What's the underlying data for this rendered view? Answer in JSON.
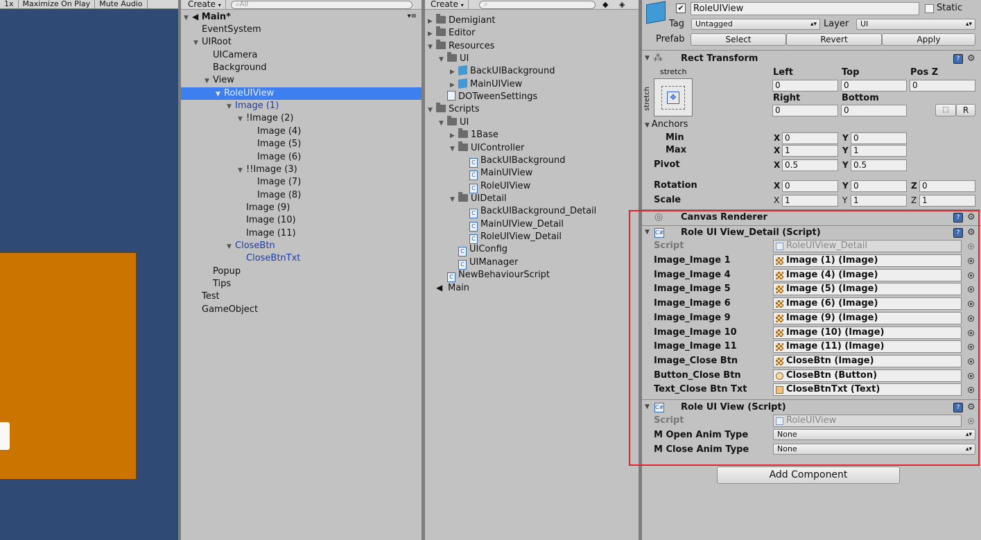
{
  "game": {
    "toolbar": [
      "1x",
      "Maximize On Play",
      "Mute Audio"
    ]
  },
  "hierarchy": {
    "create_label": "Create",
    "search_placeholder": "All",
    "scene_name": "Main*",
    "items": [
      {
        "label": "EventSystem",
        "depth": 0,
        "fold": ""
      },
      {
        "label": "UIRoot",
        "depth": 0,
        "fold": "open"
      },
      {
        "label": "UICamera",
        "depth": 1,
        "fold": ""
      },
      {
        "label": "Background",
        "depth": 1,
        "fold": ""
      },
      {
        "label": "View",
        "depth": 1,
        "fold": "open"
      },
      {
        "label": "RoleUIView",
        "depth": 2,
        "fold": "open",
        "selected": true
      },
      {
        "label": "Image (1)",
        "depth": 3,
        "fold": "open",
        "prefab": true
      },
      {
        "label": "!Image (2)",
        "depth": 4,
        "fold": "open"
      },
      {
        "label": "Image (4)",
        "depth": 5,
        "fold": ""
      },
      {
        "label": "Image (5)",
        "depth": 5,
        "fold": ""
      },
      {
        "label": "Image (6)",
        "depth": 5,
        "fold": ""
      },
      {
        "label": "!!Image (3)",
        "depth": 4,
        "fold": "open"
      },
      {
        "label": "Image (7)",
        "depth": 5,
        "fold": ""
      },
      {
        "label": "Image (8)",
        "depth": 5,
        "fold": ""
      },
      {
        "label": "Image (9)",
        "depth": 4,
        "fold": ""
      },
      {
        "label": "Image (10)",
        "depth": 4,
        "fold": ""
      },
      {
        "label": "Image (11)",
        "depth": 4,
        "fold": ""
      },
      {
        "label": "CloseBtn",
        "depth": 3,
        "fold": "open",
        "prefab": true
      },
      {
        "label": "CloseBtnTxt",
        "depth": 4,
        "fold": "",
        "prefab": true
      },
      {
        "label": "Popup",
        "depth": 1,
        "fold": ""
      },
      {
        "label": "Tips",
        "depth": 1,
        "fold": ""
      },
      {
        "label": "Test",
        "depth": 0,
        "fold": ""
      },
      {
        "label": "GameObject",
        "depth": 0,
        "fold": ""
      }
    ]
  },
  "project": {
    "create_label": "Create",
    "items": [
      {
        "label": "Demigiant",
        "depth": 0,
        "fold": "closed",
        "icon": "folder"
      },
      {
        "label": "Editor",
        "depth": 0,
        "fold": "closed",
        "icon": "folder"
      },
      {
        "label": "Resources",
        "depth": 0,
        "fold": "open",
        "icon": "folder"
      },
      {
        "label": "UI",
        "depth": 1,
        "fold": "open",
        "icon": "folder"
      },
      {
        "label": "BackUIBackground",
        "depth": 2,
        "fold": "closed",
        "icon": "prefab"
      },
      {
        "label": "MainUIView",
        "depth": 2,
        "fold": "closed",
        "icon": "prefab"
      },
      {
        "label": "DOTweenSettings",
        "depth": 1,
        "fold": "",
        "icon": "asset"
      },
      {
        "label": "Scripts",
        "depth": 0,
        "fold": "open",
        "icon": "folder"
      },
      {
        "label": "UI",
        "depth": 1,
        "fold": "open",
        "icon": "folder"
      },
      {
        "label": "1Base",
        "depth": 2,
        "fold": "closed",
        "icon": "folder"
      },
      {
        "label": "UIController",
        "depth": 2,
        "fold": "open",
        "icon": "folder"
      },
      {
        "label": "BackUIBackground",
        "depth": 3,
        "fold": "",
        "icon": "script"
      },
      {
        "label": "MainUIView",
        "depth": 3,
        "fold": "",
        "icon": "script"
      },
      {
        "label": "RoleUIView",
        "depth": 3,
        "fold": "",
        "icon": "script"
      },
      {
        "label": "UIDetail",
        "depth": 2,
        "fold": "open",
        "icon": "folder"
      },
      {
        "label": "BackUIBackground_Detail",
        "depth": 3,
        "fold": "",
        "icon": "script"
      },
      {
        "label": "MainUIView_Detail",
        "depth": 3,
        "fold": "",
        "icon": "script"
      },
      {
        "label": "RoleUIView_Detail",
        "depth": 3,
        "fold": "",
        "icon": "script"
      },
      {
        "label": "UIConfig",
        "depth": 2,
        "fold": "",
        "icon": "script"
      },
      {
        "label": "UIManager",
        "depth": 2,
        "fold": "",
        "icon": "script"
      },
      {
        "label": "NewBehaviourScript",
        "depth": 1,
        "fold": "",
        "icon": "script"
      },
      {
        "label": "Main",
        "depth": 0,
        "fold": "",
        "icon": "unity"
      }
    ]
  },
  "inspector": {
    "object_name": "RoleUIView",
    "static_label": "Static",
    "tag_label": "Tag",
    "tag_value": "Untagged",
    "layer_label": "Layer",
    "layer_value": "UI",
    "prefab_label": "Prefab",
    "prefab_buttons": [
      "Select",
      "Revert",
      "Apply"
    ],
    "rect": {
      "title": "Rect Transform",
      "anchor_preset": "stretch",
      "anchor_preset_side": "stretch",
      "left_label": "Left",
      "top_label": "Top",
      "posz_label": "Pos Z",
      "left": "0",
      "top": "0",
      "posz": "0",
      "right_label": "Right",
      "bottom_label": "Bottom",
      "right": "0",
      "bottom": "0",
      "r_button": "R",
      "anchors_label": "Anchors",
      "min_label": "Min",
      "max_label": "Max",
      "min_x": "0",
      "min_y": "0",
      "max_x": "1",
      "max_y": "1",
      "pivot_label": "Pivot",
      "pivot_x": "0.5",
      "pivot_y": "0.5",
      "rotation_label": "Rotation",
      "rot_x": "0",
      "rot_y": "0",
      "rot_z": "0",
      "scale_label": "Scale",
      "scale_x": "1",
      "scale_y": "1",
      "scale_z": "1"
    },
    "canvas_renderer_title": "Canvas Renderer",
    "detail": {
      "title": "Role UI View_Detail (Script)",
      "script_label": "Script",
      "script_value": "RoleUIView_Detail",
      "fields": [
        {
          "label": "Image_Image 1",
          "value": "Image (1) (Image)",
          "icon": "image"
        },
        {
          "label": "Image_Image 4",
          "value": "Image (4) (Image)",
          "icon": "image"
        },
        {
          "label": "Image_Image 5",
          "value": "Image (5) (Image)",
          "icon": "image"
        },
        {
          "label": "Image_Image 6",
          "value": "Image (6) (Image)",
          "icon": "image"
        },
        {
          "label": "Image_Image 9",
          "value": "Image (9) (Image)",
          "icon": "image"
        },
        {
          "label": "Image_Image 10",
          "value": "Image (10) (Image)",
          "icon": "image"
        },
        {
          "label": "Image_Image 11",
          "value": "Image (11) (Image)",
          "icon": "image"
        },
        {
          "label": "Image_Close Btn",
          "value": "CloseBtn (Image)",
          "icon": "image"
        },
        {
          "label": "Button_Close Btn",
          "value": "CloseBtn (Button)",
          "icon": "button"
        },
        {
          "label": "Text_Close Btn Txt",
          "value": "CloseBtnTxt (Text)",
          "icon": "text"
        }
      ]
    },
    "view": {
      "title": "Role UI View (Script)",
      "script_label": "Script",
      "script_value": "RoleUIView",
      "open_label": "M Open Anim Type",
      "open_value": "None",
      "close_label": "M Close Anim Type",
      "close_value": "None"
    },
    "add_component": "Add Component"
  },
  "colors": {
    "selection": "#3d7ff0",
    "highlight_box": "#e0262a",
    "game_background": "#2f4a75",
    "game_panel": "#cc7400"
  }
}
